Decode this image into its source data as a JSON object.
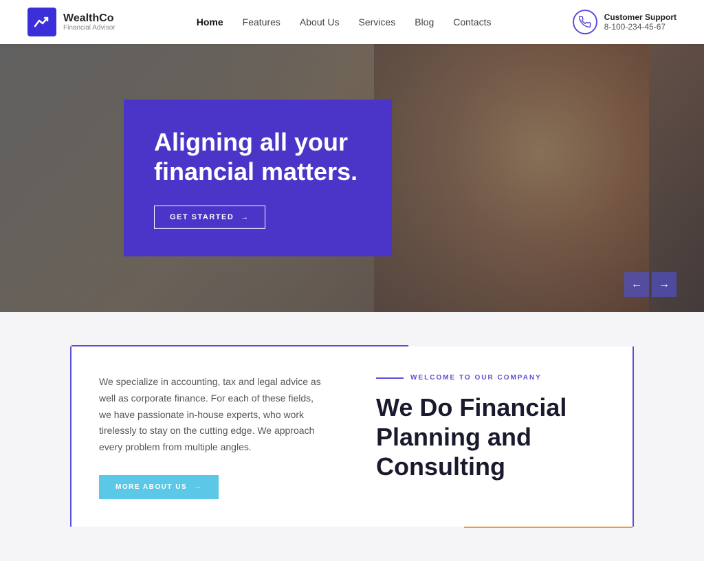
{
  "brand": {
    "name": "WealthCo",
    "tagline": "Financial Advisor",
    "logo_bg": "#3a2fd8"
  },
  "nav": {
    "items": [
      {
        "label": "Home",
        "active": true
      },
      {
        "label": "Features",
        "active": false
      },
      {
        "label": "About Us",
        "active": false
      },
      {
        "label": "Services",
        "active": false
      },
      {
        "label": "Blog",
        "active": false
      },
      {
        "label": "Contacts",
        "active": false
      }
    ]
  },
  "support": {
    "label": "Customer Support",
    "phone": "8-100-234-45-67"
  },
  "hero": {
    "title": "Aligning all your financial matters.",
    "cta_label": "GET STARTED",
    "arrow_left": "←",
    "arrow_right": "→"
  },
  "company_section": {
    "welcome_label": "WELCOME TO OUR COMPANY",
    "description": "We specialize in accounting, tax and legal advice as well as corporate finance. For each of these fields, we have passionate in-house experts, who work tirelessly to stay on the cutting edge. We approach every problem from multiple angles.",
    "cta_label": "MORE ABOUT US",
    "heading_line1": "We Do Financial",
    "heading_line2": "Planning and",
    "heading_line3": "Consulting"
  }
}
